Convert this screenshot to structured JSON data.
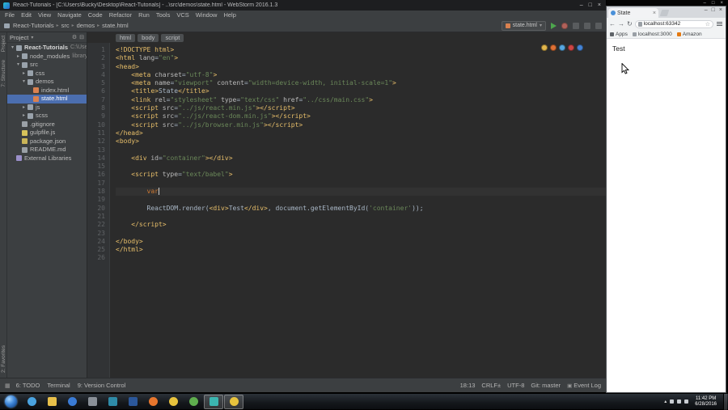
{
  "webstorm": {
    "title": "React-Tutorials - [C:\\Users\\Bucky\\Desktop\\React-Tutorials] - ..\\src\\demos\\state.html - WebStorm 2016.1.3",
    "controls": {
      "minimize": "–",
      "maximize": "□",
      "close": "×"
    },
    "icons": {
      "expanded": "▾",
      "collapsed": "▸",
      "crumb_sep": "▸",
      "dropdown": "▾",
      "gear": "⚙",
      "collapse_all": "⊟",
      "grid": "▦",
      "event_log": "▣"
    },
    "menu": [
      "File",
      "Edit",
      "View",
      "Navigate",
      "Code",
      "Refactor",
      "Run",
      "Tools",
      "VCS",
      "Window",
      "Help"
    ],
    "navbar": [
      "React-Tutorials",
      "src",
      "demos",
      "state.html"
    ],
    "toolbar": {
      "run_config": "state.html"
    },
    "tool_stripe": {
      "top": "Project",
      "mid": "7: Structure",
      "bottom": "2: Favorites"
    },
    "project": {
      "header": "Project",
      "tree": [
        {
          "label": "React-Tutorials",
          "ann": "C:\\Users\\Bu",
          "ind": 0,
          "icon": "folder",
          "exp": true,
          "bold": true
        },
        {
          "label": "node_modules",
          "ann": "library ro",
          "ind": 1,
          "icon": "folder",
          "exp": false
        },
        {
          "label": "src",
          "ind": 1,
          "icon": "folder",
          "exp": true
        },
        {
          "label": "css",
          "ind": 2,
          "icon": "folder",
          "exp": false
        },
        {
          "label": "demos",
          "ind": 2,
          "icon": "folder",
          "exp": true
        },
        {
          "label": "index.html",
          "ind": 3,
          "icon": "html"
        },
        {
          "label": "state.html",
          "ind": 3,
          "icon": "html",
          "sel": true
        },
        {
          "label": "js",
          "ind": 2,
          "icon": "folder",
          "exp": false
        },
        {
          "label": "scss",
          "ind": 2,
          "icon": "folder",
          "exp": false
        },
        {
          "label": ".gitignore",
          "ind": 1,
          "icon": "file"
        },
        {
          "label": "gulpfile.js",
          "ind": 1,
          "icon": "js"
        },
        {
          "label": "package.json",
          "ind": 1,
          "icon": "json"
        },
        {
          "label": "README.md",
          "ind": 1,
          "icon": "file"
        },
        {
          "label": "External Libraries",
          "ind": 0,
          "icon": "lib"
        }
      ]
    },
    "editor": {
      "breadcrumbs": [
        "html",
        "body",
        "script"
      ],
      "browser_icons": [
        "chrome",
        "firefox",
        "safari",
        "opera",
        "ie"
      ],
      "lines": [
        {
          "t": [
            [
              "t",
              "<!DOCTYPE html>"
            ]
          ]
        },
        {
          "t": [
            [
              "t",
              "<html "
            ],
            [
              "a",
              "lang"
            ],
            [
              "p",
              "="
            ],
            [
              "s",
              "\"en\""
            ],
            [
              "t",
              ">"
            ]
          ]
        },
        {
          "t": [
            [
              "t",
              "<head>"
            ]
          ]
        },
        {
          "t": [
            [
              "p",
              "    "
            ],
            [
              "t",
              "<meta "
            ],
            [
              "a",
              "charset"
            ],
            [
              "p",
              "="
            ],
            [
              "s",
              "\"utf-8\""
            ],
            [
              "t",
              ">"
            ]
          ]
        },
        {
          "t": [
            [
              "p",
              "    "
            ],
            [
              "t",
              "<meta "
            ],
            [
              "a",
              "name"
            ],
            [
              "p",
              "="
            ],
            [
              "s",
              "\"viewport\""
            ],
            [
              "p",
              " "
            ],
            [
              "a",
              "content"
            ],
            [
              "p",
              "="
            ],
            [
              "s",
              "\"width=device-width, initial-scale=1\""
            ],
            [
              "t",
              ">"
            ]
          ]
        },
        {
          "t": [
            [
              "p",
              "    "
            ],
            [
              "t",
              "<title>"
            ],
            [
              "p",
              "State"
            ],
            [
              "t",
              "</title>"
            ]
          ]
        },
        {
          "t": [
            [
              "p",
              "    "
            ],
            [
              "t",
              "<link "
            ],
            [
              "a",
              "rel"
            ],
            [
              "p",
              "="
            ],
            [
              "s",
              "\"stylesheet\""
            ],
            [
              "p",
              " "
            ],
            [
              "a",
              "type"
            ],
            [
              "p",
              "="
            ],
            [
              "s",
              "\"text/css\""
            ],
            [
              "p",
              " "
            ],
            [
              "a",
              "href"
            ],
            [
              "p",
              "="
            ],
            [
              "s",
              "\"../css/main.css\""
            ],
            [
              "t",
              ">"
            ]
          ]
        },
        {
          "t": [
            [
              "p",
              "    "
            ],
            [
              "t",
              "<script "
            ],
            [
              "a",
              "src"
            ],
            [
              "p",
              "="
            ],
            [
              "s",
              "\"../js/react.min.js\""
            ],
            [
              "t",
              "></script>"
            ]
          ]
        },
        {
          "t": [
            [
              "p",
              "    "
            ],
            [
              "t",
              "<script "
            ],
            [
              "a",
              "src"
            ],
            [
              "p",
              "="
            ],
            [
              "s",
              "\"../js/react-dom.min.js\""
            ],
            [
              "t",
              "></script>"
            ]
          ]
        },
        {
          "t": [
            [
              "p",
              "    "
            ],
            [
              "t",
              "<script "
            ],
            [
              "a",
              "src"
            ],
            [
              "p",
              "="
            ],
            [
              "s",
              "\"../js/browser.min.js\""
            ],
            [
              "t",
              "></script>"
            ]
          ]
        },
        {
          "t": [
            [
              "t",
              "</head>"
            ]
          ]
        },
        {
          "t": [
            [
              "t",
              "<body>"
            ]
          ]
        },
        {
          "t": []
        },
        {
          "t": [
            [
              "p",
              "    "
            ],
            [
              "t",
              "<div "
            ],
            [
              "a",
              "id"
            ],
            [
              "p",
              "="
            ],
            [
              "s",
              "\"container\""
            ],
            [
              "t",
              "></div>"
            ]
          ]
        },
        {
          "t": []
        },
        {
          "t": [
            [
              "p",
              "    "
            ],
            [
              "t",
              "<script "
            ],
            [
              "a",
              "type"
            ],
            [
              "p",
              "="
            ],
            [
              "s",
              "\"text/babel\""
            ],
            [
              "t",
              ">"
            ]
          ]
        },
        {
          "t": []
        },
        {
          "t": [
            [
              "p",
              "        "
            ],
            [
              "k",
              "var"
            ]
          ],
          "caret": true,
          "cur": true
        },
        {
          "t": []
        },
        {
          "t": [
            [
              "p",
              "        ReactDOM.render("
            ],
            [
              "t",
              "<div>"
            ],
            [
              "p",
              "Test"
            ],
            [
              "t",
              "</div>"
            ],
            [
              "p",
              ", document.getElementById("
            ],
            [
              "s",
              "'container'"
            ],
            [
              "p",
              "));"
            ]
          ]
        },
        {
          "t": []
        },
        {
          "t": [
            [
              "p",
              "    "
            ],
            [
              "t",
              "</script>"
            ]
          ]
        },
        {
          "t": []
        },
        {
          "t": [
            [
              "t",
              "</body>"
            ]
          ]
        },
        {
          "t": [
            [
              "t",
              "</html>"
            ]
          ]
        },
        {
          "t": []
        }
      ]
    },
    "statusbar": {
      "left": [
        "6: TODO",
        "Terminal",
        "9: Version Control"
      ],
      "position": "18:13",
      "line_sep": "CRLF±",
      "encoding": "UTF-8",
      "vcs": "Git: master",
      "event_log": "Event Log"
    }
  },
  "chrome": {
    "tab": "State",
    "tab_close": "×",
    "controls": [
      "–",
      "□",
      "×"
    ],
    "icons": {
      "back": "←",
      "forward": "→",
      "reload": "↻",
      "star": "☆"
    },
    "url": "localhost:63342",
    "bookmarks": [
      "Apps",
      "localhost:3000",
      "Amazon"
    ],
    "page_text": "Test"
  },
  "desktop": {
    "controls": [
      "–",
      "□",
      "×"
    ]
  },
  "taskbar": {
    "tray_expand": "▴",
    "clock_time": "11:42 PM",
    "clock_date": "6/28/2016",
    "items": [
      {
        "name": "internet-explorer",
        "color": "#4aa3e0",
        "shape": "circle"
      },
      {
        "name": "file-explorer",
        "color": "#e8c04a"
      },
      {
        "name": "media-player",
        "color": "#3a7bd5",
        "shape": "circle"
      },
      {
        "name": "app-gray",
        "color": "#8a9098"
      },
      {
        "name": "app-teal",
        "color": "#2e8ba8"
      },
      {
        "name": "word",
        "color": "#2b579a"
      },
      {
        "name": "firefox",
        "color": "#e8762d",
        "shape": "circle"
      },
      {
        "name": "chrome",
        "color": "#e8c33d",
        "shape": "circle"
      },
      {
        "name": "camtasia",
        "color": "#5fae4e",
        "shape": "circle"
      },
      {
        "name": "webstorm",
        "color": "#3bb5b0",
        "active": true
      },
      {
        "name": "chrome-window",
        "color": "#e8c33d",
        "shape": "circle",
        "active": true
      }
    ]
  }
}
